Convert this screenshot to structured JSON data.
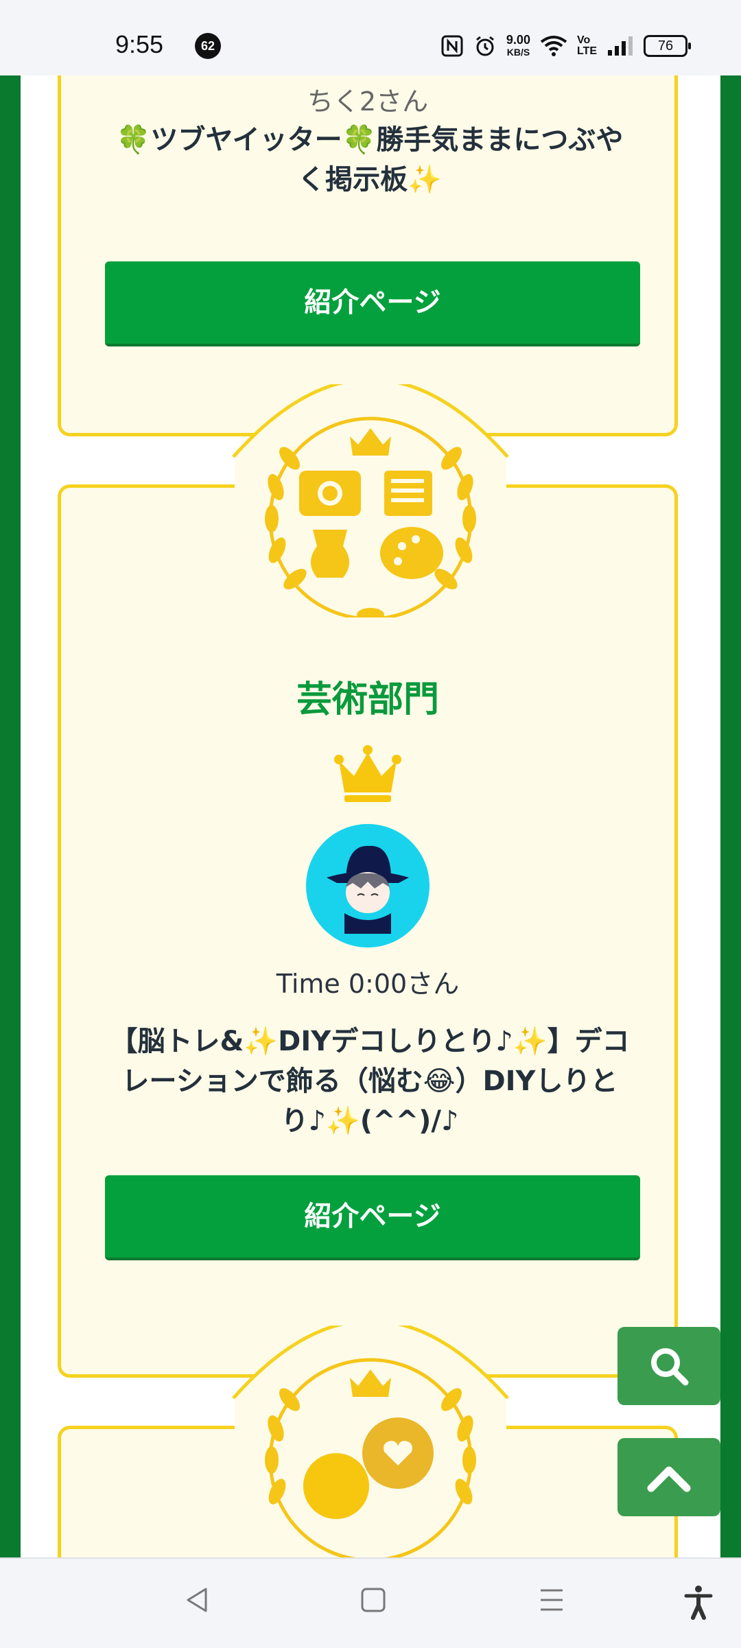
{
  "status_bar": {
    "time": "9:55",
    "notification_count": "62",
    "net_speed_value": "9.00",
    "net_speed_unit": "KB/S",
    "volte_top": "Vo",
    "volte_bottom": "LTE",
    "battery": "76"
  },
  "cards": [
    {
      "user_name": "ちく2さん",
      "description": "🍀ツブヤイッター🍀勝手気ままにつぶやく掲示板✨",
      "button_label": "紹介ページ"
    },
    {
      "category_title": "芸術部門",
      "user_name": "Time 0:00さん",
      "description": "【脳トレ&✨DIYデコしりとり♪✨】デコレーションで飾る（悩む😂）DIYしりとり♪✨(^^)/♪",
      "button_label": "紹介ページ"
    }
  ],
  "colors": {
    "frame_green": "#0a7a2f",
    "button_green": "#04a03d",
    "title_green": "#0a9a3d",
    "card_bg": "#fefbe8",
    "card_border": "#f5d21f",
    "gold": "#f5c518"
  },
  "icons": {
    "fab_search": "search-icon",
    "fab_top": "chevron-up-icon",
    "nav_back": "back-triangle-icon",
    "nav_home": "home-square-icon",
    "nav_menu": "menu-lines-icon",
    "nav_access": "accessibility-icon"
  }
}
